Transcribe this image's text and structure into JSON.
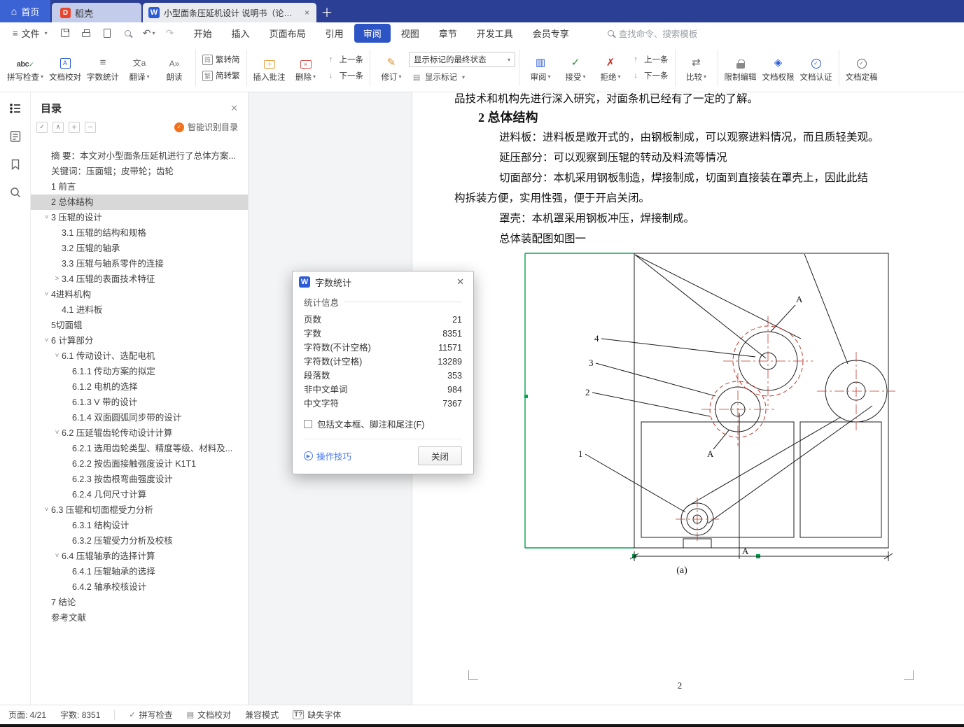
{
  "titlebar": {
    "home_tab": "首页",
    "docer_tab": "稻壳",
    "doc_tab": "小型面条压延机设计 说明书（论文）"
  },
  "menubar": {
    "file": "文件",
    "tabs": [
      "开始",
      "插入",
      "页面布局",
      "引用",
      "审阅",
      "视图",
      "章节",
      "开发工具",
      "会员专享"
    ],
    "active_tab": "审阅",
    "search_placeholder": "查找命令、搜索模板"
  },
  "ribbon": {
    "spell_check": "拼写检查",
    "doc_proof": "文档校对",
    "word_count": "字数统计",
    "translate": "翻译",
    "read_aloud": "朗读",
    "t2s": "繁转简",
    "s2t": "简转繁",
    "insert_comment": "插入批注",
    "delete_comment": "删除",
    "prev_comment": "上一条",
    "next_comment": "下一条",
    "track_changes": "修订",
    "markup_final": "显示标记的最终状态",
    "show_markup": "显示标记",
    "review": "审阅",
    "accept": "接受",
    "reject": "拒绝",
    "prev_change": "上一条",
    "next_change": "下一条",
    "compare": "比较",
    "restrict_editing": "限制编辑",
    "doc_permission": "文档权限",
    "doc_certify": "文档认证",
    "doc_finalize": "文档定稿"
  },
  "sidebar_panel": {
    "title": "目录",
    "smart_recognize": "智能识别目录",
    "items": [
      {
        "level": 1,
        "chev": "",
        "label": "摘 要：本文对小型面条压延机进行了总体方案..."
      },
      {
        "level": 1,
        "chev": "",
        "label": "关键词：压面辊；皮带轮；齿轮"
      },
      {
        "level": 1,
        "chev": "",
        "label": "1 前言"
      },
      {
        "level": 1,
        "chev": "",
        "selected": true,
        "label": "2 总体结构"
      },
      {
        "level": 1,
        "chev": "v",
        "label": "3 压辊的设计"
      },
      {
        "level": 2,
        "chev": "",
        "label": "3.1 压辊的结构和规格"
      },
      {
        "level": 2,
        "chev": "",
        "label": "3.2 压辊的轴承"
      },
      {
        "level": 2,
        "chev": "",
        "label": "3.3 压辊与轴系零件的连接"
      },
      {
        "level": 2,
        "chev": ">",
        "label": "3.4 压辊的表面技术特征"
      },
      {
        "level": 1,
        "chev": "v",
        "label": "4进料机构"
      },
      {
        "level": 2,
        "chev": "",
        "label": "4.1 进料板"
      },
      {
        "level": 1,
        "chev": "",
        "label": "5切面辊"
      },
      {
        "level": 1,
        "chev": "v",
        "label": "6 计算部分"
      },
      {
        "level": 2,
        "chev": "v",
        "label": "6.1 传动设计、选配电机"
      },
      {
        "level": 3,
        "chev": "",
        "label": "6.1.1 传动方案的拟定"
      },
      {
        "level": 3,
        "chev": "",
        "label": "6.1.2 电机的选择"
      },
      {
        "level": 3,
        "chev": "",
        "label": "6.1.3  V 带的设计"
      },
      {
        "level": 3,
        "chev": "",
        "label": "6.1.4 双面圆弧同步带的设计"
      },
      {
        "level": 2,
        "chev": "v",
        "label": "6.2 压延辊齿轮传动设计计算"
      },
      {
        "level": 3,
        "chev": "",
        "label": "6.2.1 选用齿轮类型、精度等级、材料及..."
      },
      {
        "level": 3,
        "chev": "",
        "label": "6.2.2 按齿面接触强度设计 K1T1"
      },
      {
        "level": 3,
        "chev": "",
        "label": "6.2.3 按齿根弯曲强度设计"
      },
      {
        "level": 3,
        "chev": "",
        "label": "6.2.4 几何尺寸计算"
      },
      {
        "level": 1,
        "chev": "v",
        "label": "6.3 压辊和切面棍受力分析"
      },
      {
        "level": 3,
        "chev": "",
        "label": "6.3.1 结构设计"
      },
      {
        "level": 3,
        "chev": "",
        "label": "6.3.2 压辊受力分析及校核"
      },
      {
        "level": 2,
        "chev": "v",
        "label": "6.4 压辊轴承的选择计算"
      },
      {
        "level": 3,
        "chev": "",
        "label": "6.4.1 压辊轴承的选择"
      },
      {
        "level": 3,
        "chev": "",
        "label": "6.4.2 轴承校核设计"
      },
      {
        "level": 1,
        "chev": "",
        "label": "7 结论"
      },
      {
        "level": 1,
        "chev": "",
        "label": "参考文献"
      }
    ]
  },
  "document": {
    "partial_top_line": "品技术和机构先进行深入研究，对面条机已经有了一定的了解。",
    "heading": "2 总体结构",
    "paragraphs": [
      {
        "indent": true,
        "text": "进料板：进料板是敞开式的，由钢板制成，可以观察进料情况，而且质轻美观。"
      },
      {
        "indent": true,
        "text": "延压部分：可以观察到压辊的转动及料流等情况"
      },
      {
        "indent": true,
        "text": "切面部分：本机采用钢板制造，焊接制成，切面到直接装在罩壳上，因此此结"
      },
      {
        "indent": false,
        "text": "构拆装方便，实用性强，便于开启关闭。"
      },
      {
        "indent": true,
        "text": "罩壳：本机罩采用钢板冲压，焊接制成。"
      },
      {
        "indent": true,
        "text": "总体装配图如图一"
      }
    ],
    "figure": {
      "label_1": "1",
      "label_2": "2",
      "label_3": "3",
      "label_4": "4",
      "a_mark": "A",
      "caption": "(a)"
    },
    "page_number": "2"
  },
  "word_count_dialog": {
    "title": "字数统计",
    "section": "统计信息",
    "rows": [
      {
        "label": "页数",
        "value": "21"
      },
      {
        "label": "字数",
        "value": "8351"
      },
      {
        "label": "字符数(不计空格)",
        "value": "11571"
      },
      {
        "label": "字符数(计空格)",
        "value": "13289"
      },
      {
        "label": "段落数",
        "value": "353"
      },
      {
        "label": "非中文单词",
        "value": "984"
      },
      {
        "label": "中文字符",
        "value": "7367"
      }
    ],
    "checkbox_label": "包括文本框、脚注和尾注(F)",
    "tips_link": "操作技巧",
    "close_button": "关闭"
  },
  "statusbar": {
    "page": "页面: 4/21",
    "words": "字数: 8351",
    "spell": "拼写检查",
    "proof": "文档校对",
    "compat": "兼容模式",
    "missing_font": "缺失字体"
  }
}
